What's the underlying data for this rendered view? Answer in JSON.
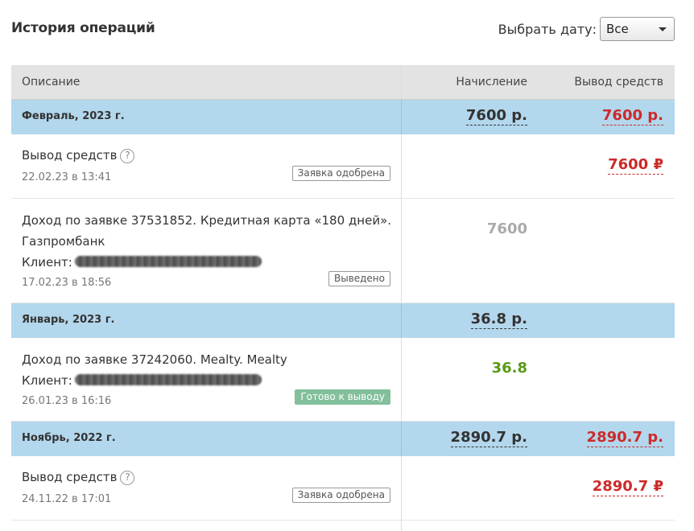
{
  "header": {
    "title": "История операций",
    "date_label": "Выбрать дату:",
    "date_value": "Все"
  },
  "table": {
    "columns": [
      "Описание",
      "Начисление",
      "Вывод средств"
    ],
    "groups": [
      {
        "month": "Февраль, 2023 г.",
        "credit_total": "7600 р.",
        "withdraw_total": "7600 р.",
        "operations": [
          {
            "title": "Вывод средств",
            "date": "22.02.23 в 13:41",
            "status": "Заявка одобрена",
            "withdraw": "7600 ₽"
          },
          {
            "line1": "Доход по заявке 37531852. Кредитная карта «180 дней».",
            "line2": "Газпромбанк",
            "client_label": "Клиент:",
            "date": "17.02.23 в 18:56",
            "status": "Выведено",
            "credit": "7600"
          }
        ]
      },
      {
        "month": "Январь, 2023 г.",
        "credit_total": "36.8 р.",
        "operations": [
          {
            "line1": "Доход по заявке 37242060. Mealty. Mealty",
            "client_label": "Клиент:",
            "date": "26.01.23 в 16:16",
            "status": "Готово к выводу",
            "credit": "36.8"
          }
        ]
      },
      {
        "month": "Ноябрь, 2022 г.",
        "credit_total": "2890.7 р.",
        "withdraw_total": "2890.7 р.",
        "operations": [
          {
            "title": "Вывод средств",
            "date": "24.11.22 в 17:01",
            "status": "Заявка одобрена",
            "withdraw": "2890.7 ₽"
          }
        ]
      }
    ]
  },
  "colors": {
    "month_row": "#b3d7ec",
    "header_row": "#e3e3e3",
    "withdraw_red": "#cc2a2a",
    "credit_green": "#5a9a18",
    "badge_green": "#82bf9a"
  },
  "icons": [
    "help-icon",
    "chevron-down-icon"
  ]
}
